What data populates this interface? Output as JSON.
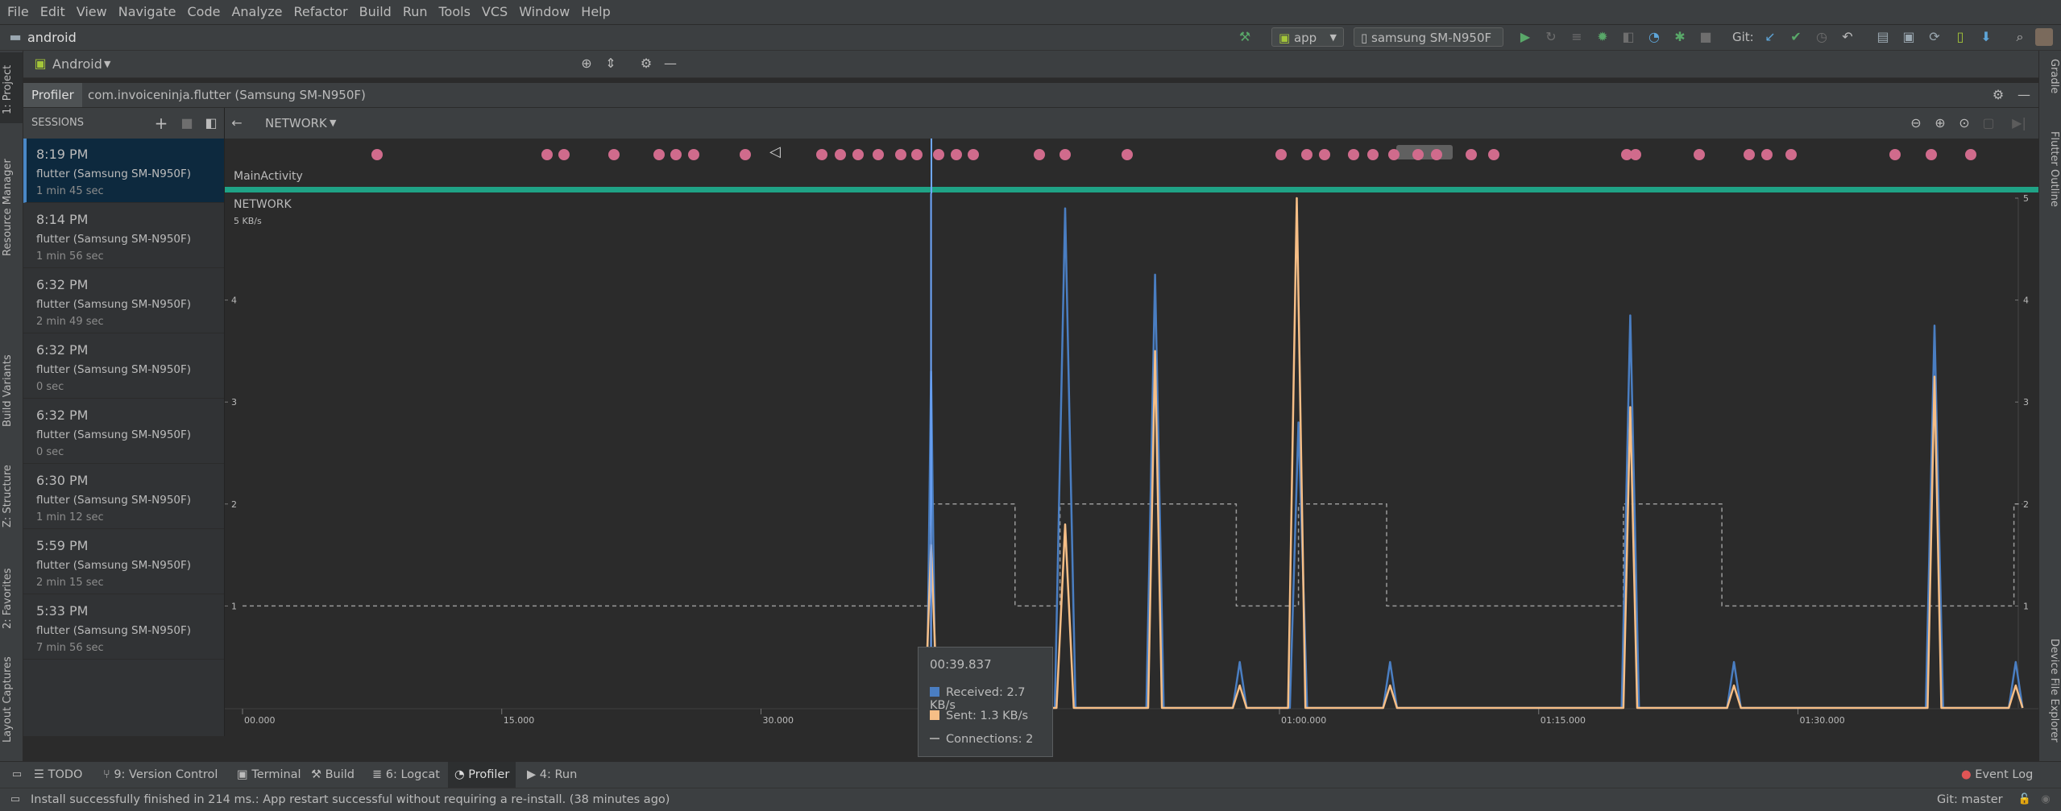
{
  "menu": [
    "File",
    "Edit",
    "View",
    "Navigate",
    "Code",
    "Analyze",
    "Refactor",
    "Build",
    "Run",
    "Tools",
    "VCS",
    "Window",
    "Help"
  ],
  "nav": {
    "project": "android",
    "run_config": "app",
    "device": "samsung SM-N950F",
    "git_label": "Git:"
  },
  "project_view": {
    "selector": "Android"
  },
  "left_stripe": [
    "1: Project",
    "Resource Manager",
    "Build Variants",
    "Z: Structure",
    "2: Favorites",
    "Layout Captures"
  ],
  "right_stripe": [
    "Gradle",
    "Flutter Outline",
    "Device File Explorer"
  ],
  "profiler": {
    "tab": "Profiler",
    "process": "com.invoiceninja.flutter (Samsung SM-N950F)",
    "sessions_label": "SESSIONS",
    "mode": "NETWORK",
    "activity": "MainActivity",
    "section": "NETWORK",
    "y_unit_label": "5 KB/s"
  },
  "sessions": [
    {
      "time": "8:19 PM",
      "device": "flutter (Samsung SM-N950F)",
      "duration": "1 min 45 sec"
    },
    {
      "time": "8:14 PM",
      "device": "flutter (Samsung SM-N950F)",
      "duration": "1 min 56 sec"
    },
    {
      "time": "6:32 PM",
      "device": "flutter (Samsung SM-N950F)",
      "duration": "2 min 49 sec"
    },
    {
      "time": "6:32 PM",
      "device": "flutter (Samsung SM-N950F)",
      "duration": "0 sec"
    },
    {
      "time": "6:32 PM",
      "device": "flutter (Samsung SM-N950F)",
      "duration": "0 sec"
    },
    {
      "time": "6:30 PM",
      "device": "flutter (Samsung SM-N950F)",
      "duration": "1 min 12 sec"
    },
    {
      "time": "5:59 PM",
      "device": "flutter (Samsung SM-N950F)",
      "duration": "2 min 15 sec"
    },
    {
      "time": "5:33 PM",
      "device": "flutter (Samsung SM-N950F)",
      "duration": "7 min 56 sec"
    }
  ],
  "tooltip": {
    "time": "00:39.837",
    "received": "Received: 2.7 KB/s",
    "sent": "Sent: 1.3 KB/s",
    "connections": "Connections:  2"
  },
  "colors": {
    "received": "#4a7ec2",
    "sent": "#f6be86",
    "connections": "#9a9a9a",
    "event": "#d06b8c",
    "activity": "#1fa386",
    "cursor": "#6fa8ff"
  },
  "chart_data": {
    "type": "line",
    "x_ticks": [
      "00.000",
      "15.000",
      "30.000",
      "45.000",
      "01:00.000",
      "01:15.000",
      "01:30.000"
    ],
    "xlim": [
      0,
      103
    ],
    "ylim": [
      0,
      5
    ],
    "y_ticks_left": [
      "4",
      "3",
      "2",
      "1"
    ],
    "y_ticks_right": [
      "5",
      "4",
      "3",
      "2",
      "1"
    ],
    "series": [
      {
        "name": "Received",
        "points": [
          [
            39.6,
            0
          ],
          [
            39.84,
            3.3
          ],
          [
            40.1,
            0
          ],
          [
            47.0,
            0
          ],
          [
            47.6,
            4.9
          ],
          [
            48.2,
            0
          ],
          [
            52.3,
            0
          ],
          [
            52.8,
            4.25
          ],
          [
            53.3,
            0
          ],
          [
            57.3,
            0
          ],
          [
            57.7,
            0.45
          ],
          [
            58.1,
            0
          ],
          [
            60.6,
            0
          ],
          [
            61.1,
            2.8
          ],
          [
            61.6,
            0
          ],
          [
            66.0,
            0
          ],
          [
            66.4,
            0.45
          ],
          [
            66.8,
            0
          ],
          [
            79.8,
            0
          ],
          [
            80.3,
            3.85
          ],
          [
            80.8,
            0
          ],
          [
            85.9,
            0
          ],
          [
            86.3,
            0.45
          ],
          [
            86.7,
            0
          ],
          [
            97.4,
            0
          ],
          [
            97.9,
            3.75
          ],
          [
            98.4,
            0
          ],
          [
            102.2,
            0
          ],
          [
            102.6,
            0.45
          ],
          [
            103,
            0
          ]
        ]
      },
      {
        "name": "Sent",
        "points": [
          [
            39.5,
            0
          ],
          [
            39.84,
            1.6
          ],
          [
            40.2,
            0
          ],
          [
            47.1,
            0
          ],
          [
            47.6,
            1.8
          ],
          [
            48.1,
            0
          ],
          [
            52.4,
            0
          ],
          [
            52.8,
            3.5
          ],
          [
            53.2,
            0
          ],
          [
            57.3,
            0
          ],
          [
            57.7,
            0.22
          ],
          [
            58.1,
            0
          ],
          [
            60.5,
            0
          ],
          [
            61.0,
            5.0
          ],
          [
            61.5,
            0
          ],
          [
            66.0,
            0
          ],
          [
            66.4,
            0.22
          ],
          [
            66.8,
            0
          ],
          [
            79.9,
            0
          ],
          [
            80.3,
            2.95
          ],
          [
            80.7,
            0
          ],
          [
            85.9,
            0
          ],
          [
            86.3,
            0.22
          ],
          [
            86.7,
            0
          ],
          [
            97.5,
            0
          ],
          [
            97.9,
            3.25
          ],
          [
            98.3,
            0
          ],
          [
            102.2,
            0
          ],
          [
            102.6,
            0.22
          ],
          [
            103,
            0
          ]
        ]
      },
      {
        "name": "Connections",
        "points": [
          [
            0,
            1
          ],
          [
            39.84,
            1
          ],
          [
            39.84,
            2
          ],
          [
            44.7,
            2
          ],
          [
            44.7,
            1
          ],
          [
            47.3,
            1
          ],
          [
            47.3,
            2
          ],
          [
            57.5,
            2
          ],
          [
            57.5,
            1
          ],
          [
            61.1,
            1
          ],
          [
            61.1,
            2
          ],
          [
            66.2,
            2
          ],
          [
            66.2,
            1
          ],
          [
            79.9,
            1
          ],
          [
            79.9,
            2
          ],
          [
            85.6,
            2
          ],
          [
            85.6,
            1
          ],
          [
            102.5,
            1
          ],
          [
            102.5,
            2
          ],
          [
            103,
            2
          ]
        ]
      }
    ]
  },
  "events_s": [
    7.8,
    17.6,
    18.6,
    21.5,
    24.1,
    25.1,
    26.1,
    29.1,
    33.5,
    34.6,
    35.6,
    36.8,
    38.1,
    39.0,
    40.3,
    41.3,
    42.3,
    46.1,
    47.6,
    51.2,
    60.1,
    61.6,
    62.6,
    64.3,
    65.4,
    66.6,
    68.0,
    69.1,
    71.1,
    72.4,
    80.1,
    80.6,
    84.3,
    87.2,
    88.2,
    89.6,
    95.6,
    97.7,
    100.0
  ],
  "bottom_tabs": [
    "TODO",
    "9: Version Control",
    "Terminal",
    "Build",
    "6: Logcat",
    "Profiler",
    "4: Run"
  ],
  "event_log": "Event Log",
  "status": {
    "message": "Install successfully finished in 214 ms.: App restart successful without requiring a re-install. (38 minutes ago)",
    "git": "Git: master"
  }
}
